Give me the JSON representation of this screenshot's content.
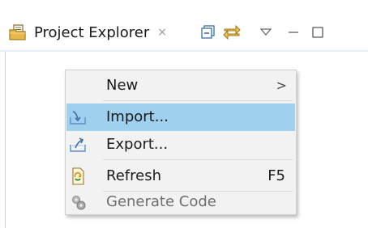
{
  "view": {
    "title": "Project Explorer",
    "close_glyph": "⨯",
    "icon": "project-explorer-icon"
  },
  "toolbar": {
    "buttons": [
      "collapse-all-icon",
      "link-with-editor-icon",
      "view-menu-icon",
      "minimize-icon",
      "maximize-icon"
    ]
  },
  "context_menu": {
    "items": [
      {
        "label": "New",
        "submenu_glyph": ">",
        "highlighted": false,
        "enabled": true
      },
      {
        "label": "Import...",
        "icon": "import-icon",
        "highlighted": true,
        "enabled": true
      },
      {
        "label": "Export...",
        "icon": "export-icon",
        "highlighted": false,
        "enabled": true
      },
      {
        "label": "Refresh",
        "icon": "refresh-icon",
        "accelerator": "F5",
        "highlighted": false,
        "enabled": true
      },
      {
        "label": "Generate Code",
        "icon": "generate-code-icon",
        "highlighted": false,
        "enabled": false
      }
    ]
  },
  "colors": {
    "highlight": "#9fd0ee",
    "menu_background": "#f2f2f2"
  }
}
